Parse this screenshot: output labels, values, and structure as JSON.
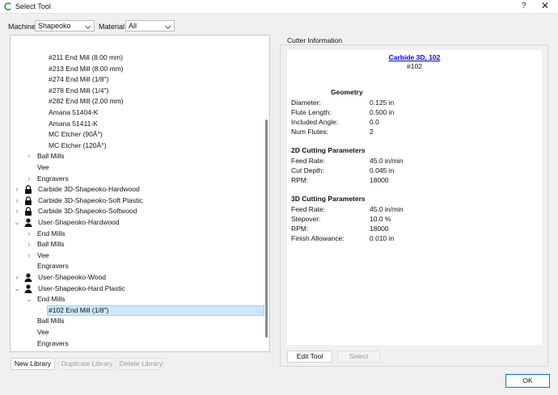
{
  "window": {
    "title": "Select Tool",
    "help_glyph": "?",
    "close_glyph": "✕"
  },
  "filters": {
    "machine_label": "Machine",
    "machine_value": "Shapeoko",
    "material_label": "Material",
    "material_value": "All"
  },
  "tree": {
    "rows": [
      {
        "label": "#211 End Mill (8.00 mm)",
        "indent": 4,
        "arrow": "",
        "icon": ""
      },
      {
        "label": "#213 End Mill (8.00 mm)",
        "indent": 4,
        "arrow": "",
        "icon": ""
      },
      {
        "label": "#274 End Mill (1/8\")",
        "indent": 4,
        "arrow": "",
        "icon": ""
      },
      {
        "label": "#278 End Mill (1/4\")",
        "indent": 4,
        "arrow": "",
        "icon": ""
      },
      {
        "label": "#282 End Mill (2.00 mm)",
        "indent": 4,
        "arrow": "",
        "icon": ""
      },
      {
        "label": "Amana 51404-K",
        "indent": 4,
        "arrow": "",
        "icon": ""
      },
      {
        "label": "Amana 51411-K",
        "indent": 4,
        "arrow": "",
        "icon": ""
      },
      {
        "label": "MC Etcher (90Â°)",
        "indent": 4,
        "arrow": "",
        "icon": ""
      },
      {
        "label": "MC Etcher (120Â°)",
        "indent": 4,
        "arrow": "",
        "icon": ""
      },
      {
        "label": "Ball Mills",
        "indent": 3,
        "arrow": "›",
        "icon": ""
      },
      {
        "label": "Vee",
        "indent": 3,
        "arrow": "",
        "icon": ""
      },
      {
        "label": "Engravers",
        "indent": 3,
        "arrow": "›",
        "icon": ""
      },
      {
        "label": "Carbide 3D-Shapeoko-Hardwood",
        "indent": 2,
        "arrow": "›",
        "icon": "lock"
      },
      {
        "label": "Carbide 3D-Shapeoko-Soft Plastic",
        "indent": 2,
        "arrow": "›",
        "icon": "lock"
      },
      {
        "label": "Carbide 3D-Shapeoko-Softwood",
        "indent": 2,
        "arrow": "›",
        "icon": "lock"
      },
      {
        "label": "User-Shapeoko-Hardwood",
        "indent": 2,
        "arrow": "⌄",
        "icon": "user"
      },
      {
        "label": "End Mills",
        "indent": 3,
        "arrow": "›",
        "icon": ""
      },
      {
        "label": "Ball Mills",
        "indent": 3,
        "arrow": "›",
        "icon": ""
      },
      {
        "label": "Vee",
        "indent": 3,
        "arrow": "›",
        "icon": ""
      },
      {
        "label": "Engravers",
        "indent": 3,
        "arrow": "",
        "icon": ""
      },
      {
        "label": "User-Shapeoko-Wood",
        "indent": 2,
        "arrow": "›",
        "icon": "user"
      },
      {
        "label": "User-Shapeoko-Hard Plastic",
        "indent": 2,
        "arrow": "⌄",
        "icon": "user"
      },
      {
        "label": "End Mills",
        "indent": 3,
        "arrow": "⌄",
        "icon": ""
      },
      {
        "label": "#102 End Mill (1/8\")",
        "indent": 4,
        "arrow": "",
        "icon": "",
        "selected": true
      },
      {
        "label": "Ball Mills",
        "indent": 3,
        "arrow": "",
        "icon": ""
      },
      {
        "label": "Vee",
        "indent": 3,
        "arrow": "",
        "icon": ""
      },
      {
        "label": "Engravers",
        "indent": 3,
        "arrow": "",
        "icon": ""
      }
    ]
  },
  "library_buttons": {
    "new": "New Library",
    "duplicate": "Duplicate Library",
    "delete": "Delete Library"
  },
  "cutter": {
    "group_title": "Cutter Information",
    "name_link": "Carbide 3D, 102",
    "number": "#102",
    "geometry_title": "Geometry",
    "geometry": [
      {
        "label": "Diameter:",
        "value": "0.125 in"
      },
      {
        "label": "Flute Length:",
        "value": "0.500 in"
      },
      {
        "label": "Included Angle:",
        "value": "0.0"
      },
      {
        "label": "Num Flutes:",
        "value": "2"
      }
    ],
    "cut2d_title": "2D Cutting Parameters",
    "cut2d": [
      {
        "label": "Feed Rate:",
        "value": "45.0 in/min"
      },
      {
        "label": "Cut Depth:",
        "value": "0.045 in"
      },
      {
        "label": "RPM:",
        "value": "18000"
      }
    ],
    "cut3d_title": "3D Cutting Parameters",
    "cut3d": [
      {
        "label": "Feed Rate:",
        "value": "45.0 in/min"
      },
      {
        "label": "Stepover:",
        "value": "10.0 %"
      },
      {
        "label": "RPM:",
        "value": "18000"
      },
      {
        "label": "Finish Allowance:",
        "value": "0.010 in"
      }
    ]
  },
  "actions": {
    "edit_tool": "Edit Tool",
    "select": "Select",
    "ok": "OK"
  }
}
